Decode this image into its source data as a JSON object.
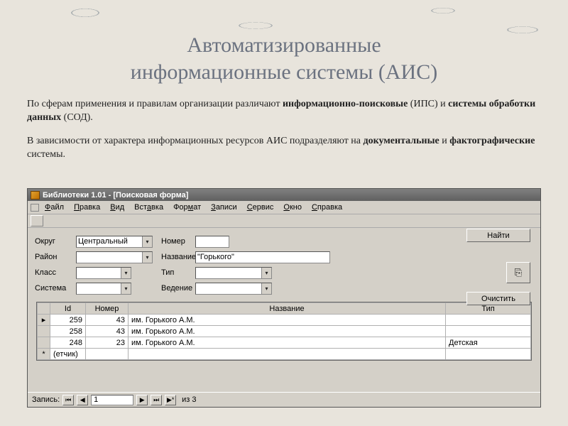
{
  "slide": {
    "title_line1": "Автоматизированные",
    "title_line2": "информационные системы (АИС)",
    "p1a": "По сферам применения и правилам организации различают ",
    "p1b": "информационно-поисковые",
    "p1c": " (ИПС) и ",
    "p1d": "системы обработки данных",
    "p1e": " (СОД).",
    "p2a": "В зависимости от характера информационных ресурсов АИС подразделяют на ",
    "p2b": "документальные",
    "p2c": " и ",
    "p2d": "фактографические",
    "p2e": " системы."
  },
  "app": {
    "title": "Библиотеки 1.01 - [Поисковая форма]",
    "menu": [
      "Файл",
      "Правка",
      "Вид",
      "Вставка",
      "Формат",
      "Записи",
      "Сервис",
      "Окно",
      "Справка"
    ],
    "labels": {
      "okrug": "Округ",
      "rayon": "Район",
      "klass": "Класс",
      "sistema": "Система",
      "nomer": "Номер",
      "nazvanie": "Название",
      "tip": "Тип",
      "vedenie": "Ведение"
    },
    "values": {
      "okrug": "Центральный",
      "nazvanie": "\"Горького\""
    },
    "buttons": {
      "find": "Найти",
      "clear": "Очистить"
    },
    "grid": {
      "cols": [
        "Id",
        "Номер",
        "Название",
        "Тип"
      ],
      "rows": [
        {
          "id": "259",
          "num": "43",
          "name": "им. Горького А.М.",
          "type": ""
        },
        {
          "id": "258",
          "num": "43",
          "name": "им. Горького А.М.",
          "type": ""
        },
        {
          "id": "248",
          "num": "23",
          "name": "им. Горького А.М.",
          "type": "Детская"
        }
      ],
      "newrow": "(етчик)"
    },
    "status": {
      "label": "Запись:",
      "pos": "1",
      "total": "из 3"
    }
  }
}
